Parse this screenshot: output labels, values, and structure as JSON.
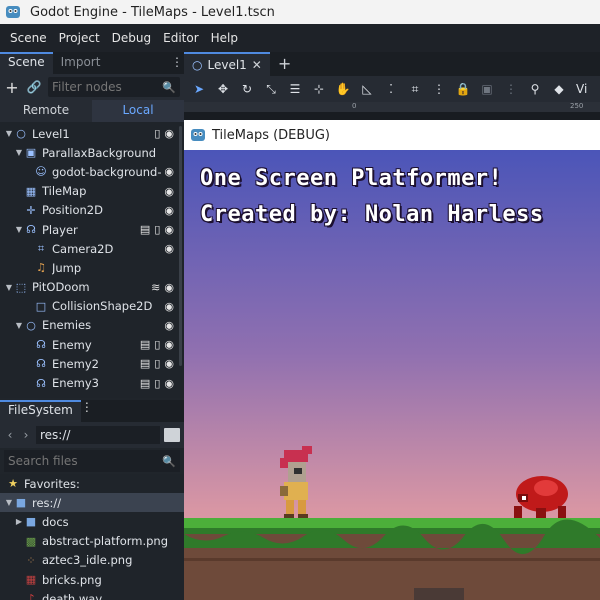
{
  "window": {
    "title": "Godot Engine - TileMaps - Level1.tscn"
  },
  "menu": [
    "Scene",
    "Project",
    "Debug",
    "Editor",
    "Help"
  ],
  "scene_dock": {
    "tabs": [
      "Scene",
      "Import"
    ],
    "filter_placeholder": "Filter nodes",
    "remote_label": "Remote",
    "local_label": "Local",
    "nodes": [
      {
        "label": "Level1",
        "icon": "node2d-icon"
      },
      {
        "label": "ParallaxBackground",
        "icon": "parallax-icon"
      },
      {
        "label": "godot-background-",
        "icon": "sprite-icon"
      },
      {
        "label": "TileMap",
        "icon": "tilemap-icon"
      },
      {
        "label": "Position2D",
        "icon": "position-icon"
      },
      {
        "label": "Player",
        "icon": "kinematic-icon"
      },
      {
        "label": "Camera2D",
        "icon": "camera-icon"
      },
      {
        "label": "Jump",
        "icon": "audio-icon"
      },
      {
        "label": "PitODoom",
        "icon": "area-icon"
      },
      {
        "label": "CollisionShape2D",
        "icon": "collision-icon"
      },
      {
        "label": "Enemies",
        "icon": "node2d-icon"
      },
      {
        "label": "Enemy",
        "icon": "kinematic-icon"
      },
      {
        "label": "Enemy2",
        "icon": "kinematic-icon"
      },
      {
        "label": "Enemy3",
        "icon": "kinematic-icon"
      }
    ]
  },
  "filesystem_dock": {
    "tab": "FileSystem",
    "path": "res://",
    "search_placeholder": "Search files",
    "items": [
      {
        "label": "Favorites:",
        "icon": "star-icon"
      },
      {
        "label": "res://",
        "icon": "folder-icon"
      },
      {
        "label": "docs",
        "icon": "folder-icon"
      },
      {
        "label": "abstract-platform.png",
        "icon": "image-icon"
      },
      {
        "label": "aztec3_idle.png",
        "icon": "image-icon"
      },
      {
        "label": "bricks.png",
        "icon": "image-icon"
      },
      {
        "label": "death.wav",
        "icon": "audio-icon"
      }
    ]
  },
  "editor": {
    "scene_tab": "Level1",
    "ruler_marks": [
      "0",
      "250"
    ],
    "view_label": "Vi"
  },
  "game": {
    "window_title": "TileMaps (DEBUG)",
    "line1": "One Screen Platformer!",
    "line2": "Created by: Nolan Harless"
  },
  "colors": {
    "accent": "#4f8ae0",
    "sky_top": "#4b55b8",
    "sky_bottom": "#e2a0a4",
    "grass": "#4caf3a",
    "dirt": "#6e4a3a"
  }
}
